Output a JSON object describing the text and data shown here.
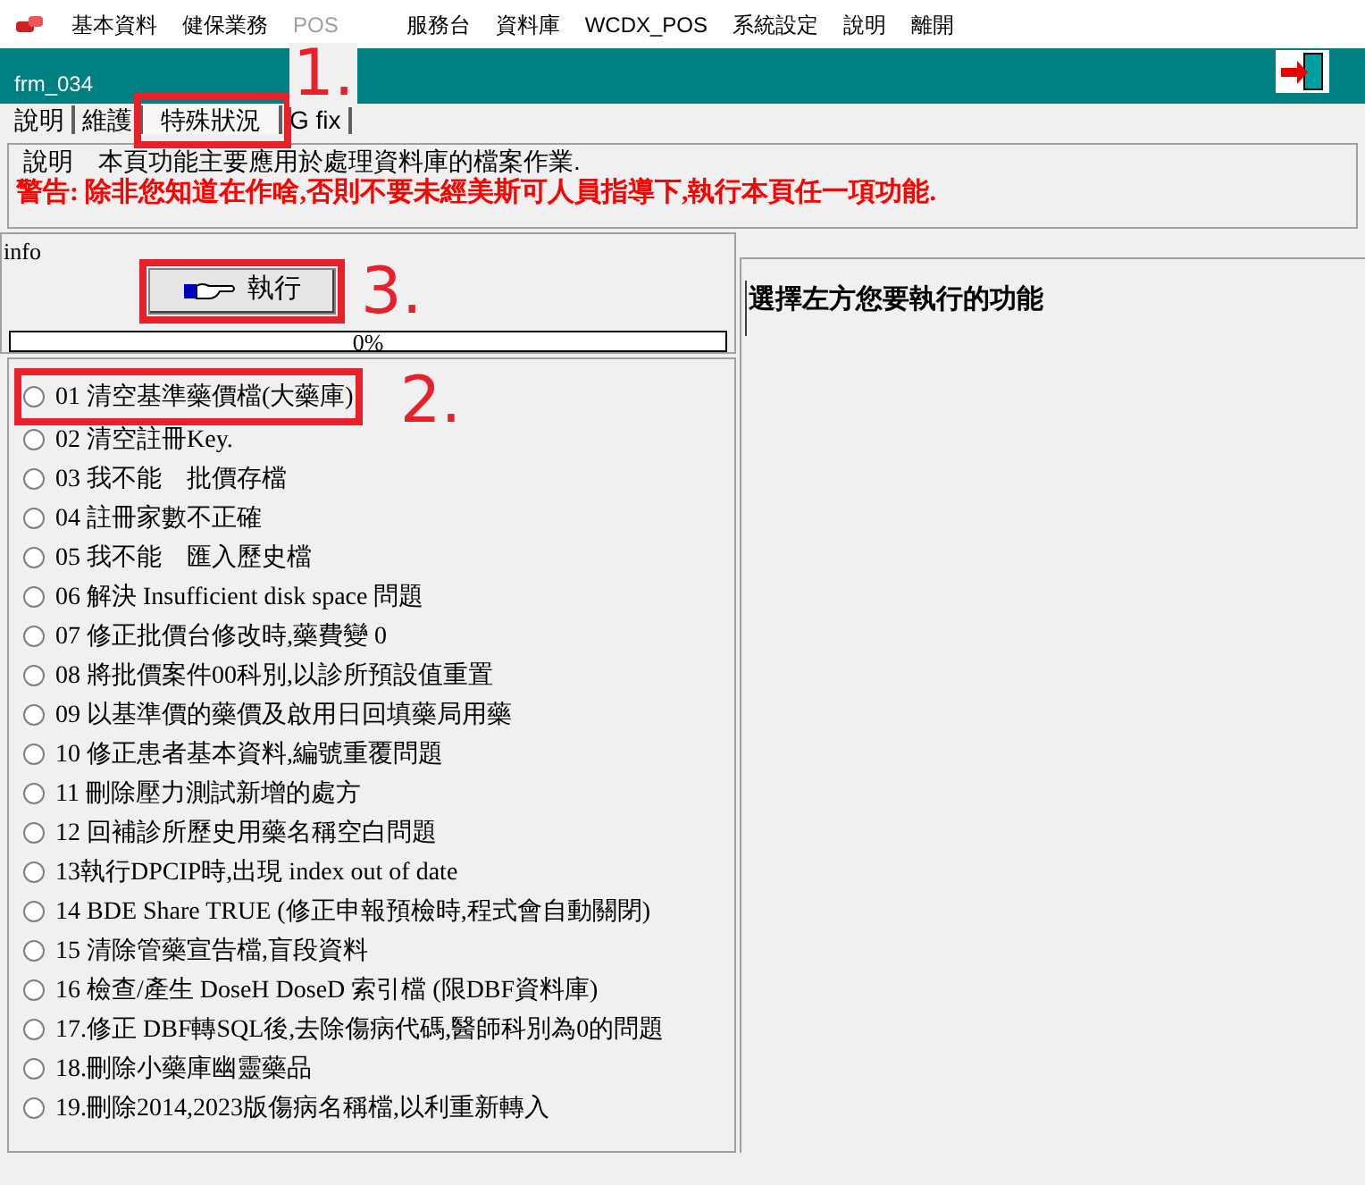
{
  "menu": [
    {
      "label": "基本資料",
      "disabled": false
    },
    {
      "label": "健保業務",
      "disabled": false
    },
    {
      "label": "POS",
      "disabled": true
    },
    {
      "label": "服務台",
      "disabled": false
    },
    {
      "label": "資料庫",
      "disabled": false
    },
    {
      "label": "WCDX_POS",
      "disabled": false
    },
    {
      "label": "系統設定",
      "disabled": false
    },
    {
      "label": "說明",
      "disabled": false
    },
    {
      "label": "離開",
      "disabled": false
    }
  ],
  "window": {
    "title": "frm_034"
  },
  "tabs": [
    {
      "label": "說明",
      "selected": false
    },
    {
      "label": "維護",
      "selected": false
    },
    {
      "label": "特殊狀況",
      "selected": true,
      "annotation": "1."
    },
    {
      "label": "G fix",
      "selected": false
    }
  ],
  "description": {
    "caption": "說明",
    "text": "本頁功能主要應用於處理資料庫的檔案作業.",
    "warning": "警告:  除非您知道在作啥,否則不要未經美斯可人員指導下,執行本頁任一項功能."
  },
  "info": {
    "caption": "info",
    "button": {
      "label": "執行",
      "annotation": "3."
    },
    "progress": {
      "level": 0,
      "reading": "0%"
    }
  },
  "options": [
    {
      "label": "01 清空基準藥價檔(大藥庫)",
      "selected": false,
      "annotation": "2."
    },
    {
      "label": "02 清空註冊Key.",
      "selected": false
    },
    {
      "label": "03 我不能　批價存檔",
      "selected": false
    },
    {
      "label": "04 註冊家數不正確",
      "selected": false
    },
    {
      "label": "05 我不能　匯入歷史檔",
      "selected": false
    },
    {
      "label": "06 解決 Insufficient disk space 問題",
      "selected": false
    },
    {
      "label": "07 修正批價台修改時,藥費變 0",
      "selected": false
    },
    {
      "label": "08 將批價案件00科別,以診所預設值重置",
      "selected": false
    },
    {
      "label": "09 以基準價的藥價及啟用日回填藥局用藥",
      "selected": false
    },
    {
      "label": "10 修正患者基本資料,編號重覆問題",
      "selected": false
    },
    {
      "label": "11 刪除壓力測試新增的處方",
      "selected": false
    },
    {
      "label": "12 回補診所歷史用藥名稱空白問題",
      "selected": false
    },
    {
      "label": "13執行DPCIP時,出現 index out of date",
      "selected": false
    },
    {
      "label": "14 BDE Share TRUE (修正申報預檢時,程式會自動關閉)",
      "selected": false
    },
    {
      "label": "15 清除管藥宣告檔,盲段資料",
      "selected": false
    },
    {
      "label": "16 檢查/產生  DoseH DoseD  索引檔 (限DBF資料庫)",
      "selected": false
    },
    {
      "label": "17.修正 DBF轉SQL後,去除傷病代碼,醫師科別為0的問題",
      "selected": false
    },
    {
      "label": "18.刪除小藥庫幽靈藥品",
      "selected": false
    },
    {
      "label": "19.刪除2014,2023版傷病名稱檔,以利重新轉入",
      "selected": false
    }
  ],
  "result": {
    "text": "選擇左方您要執行的功能"
  }
}
